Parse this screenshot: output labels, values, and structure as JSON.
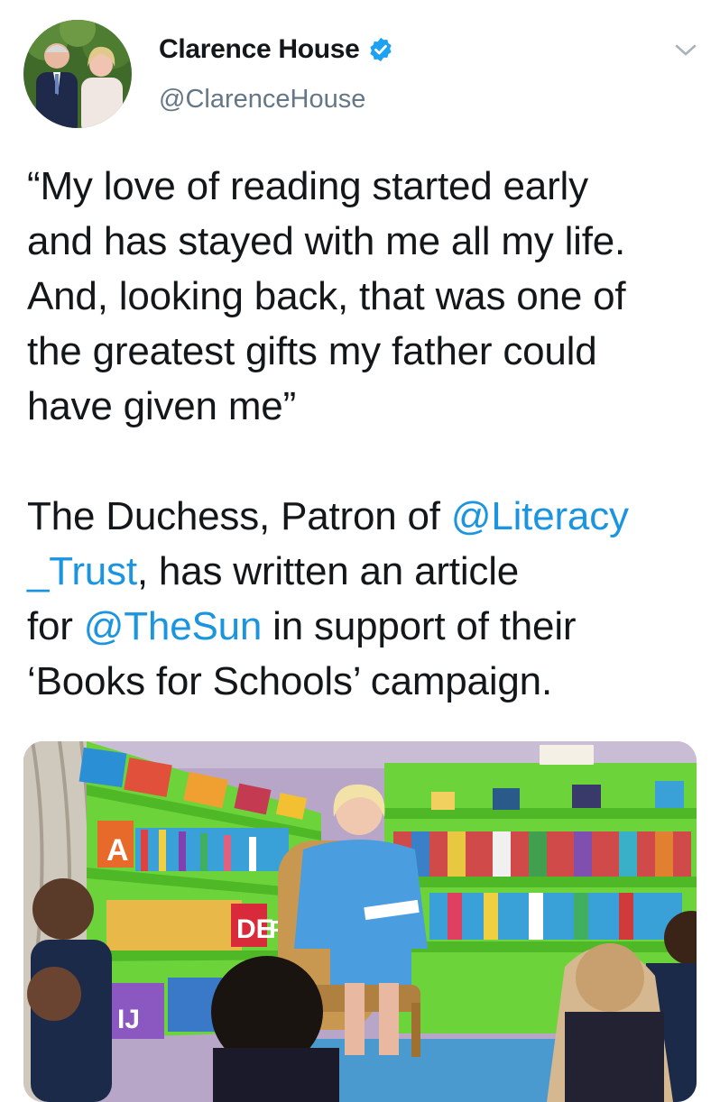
{
  "account": {
    "display_name": "Clarence House",
    "handle": "@ClarenceHouse",
    "verified_icon": "verified-badge-icon",
    "menu_icon": "chevron-down-icon"
  },
  "tweet": {
    "quote_lines": [
      "“My love of reading started early",
      "and has stayed with me all my life.",
      "And, looking back, that was one of",
      "the greatest gifts my father could",
      "have given me”"
    ],
    "line6_pre": "The Duchess, Patron of ",
    "mention_literacy_1": "@Literacy",
    "mention_literacy_2": "_Trust",
    "line7_post": ", has written an article",
    "line8_pre": "for ",
    "mention_sun": "@TheSun",
    "line8_post": " in support of their",
    "line9": "‘Books for Schools’ campaign."
  },
  "colors": {
    "link": "#1b95e0",
    "verified": "#1da1f2",
    "secondary_text": "#657786"
  },
  "photo": {
    "shelf_letters": [
      "A",
      "DE",
      "F",
      "IJ"
    ]
  }
}
